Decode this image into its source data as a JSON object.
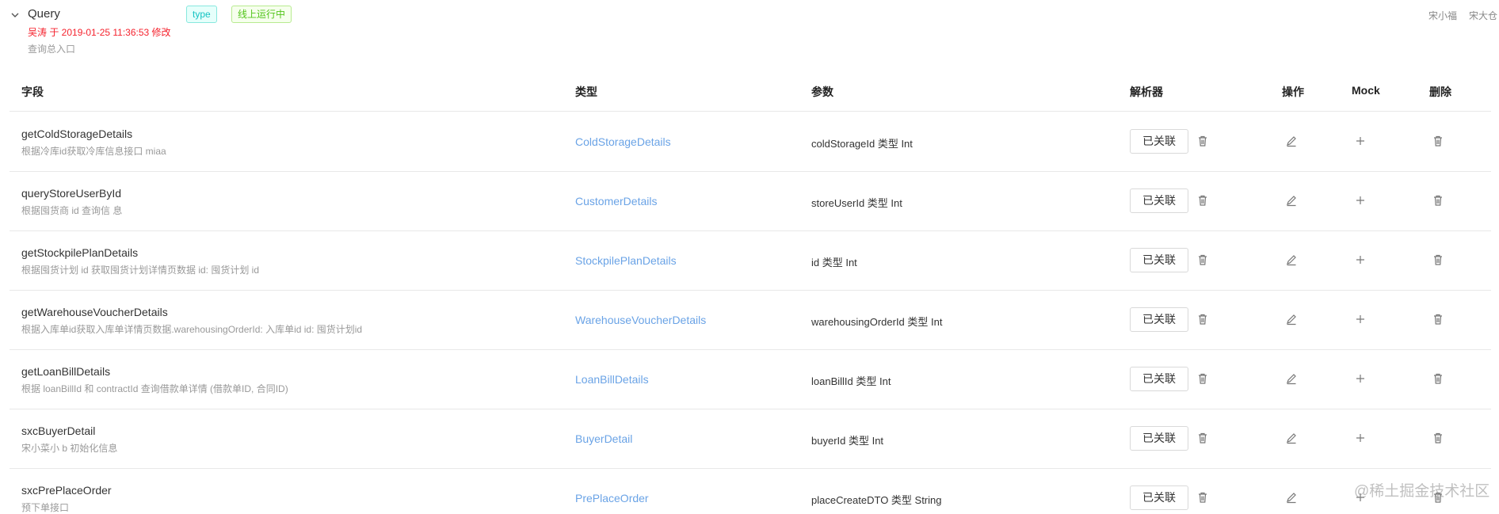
{
  "header": {
    "query_title": "Query",
    "tag_type": "type",
    "tag_status": "线上运行中",
    "modified": "吴涛 于 2019-01-25 11:36:53 修改",
    "description": "查询总入口",
    "users": [
      "宋小福",
      "宋大仓"
    ]
  },
  "table": {
    "columns": [
      "字段",
      "类型",
      "参数",
      "解析器",
      "操作",
      "Mock",
      "删除"
    ],
    "linked_label": "已关联",
    "rows": [
      {
        "field": "getColdStorageDetails",
        "desc": "根据冷库id获取冷库信息接口 miaa",
        "type": "ColdStorageDetails",
        "args": "coldStorageId 类型 Int"
      },
      {
        "field": "queryStoreUserById",
        "desc": "根据囤货商 id 查询信 息",
        "type": "CustomerDetails",
        "args": "storeUserId 类型 Int"
      },
      {
        "field": "getStockpilePlanDetails",
        "desc": "根据囤货计划 id 获取囤货计划详情页数据 id: 囤货计划 id",
        "type": "StockpilePlanDetails",
        "args": "id 类型 Int"
      },
      {
        "field": "getWarehouseVoucherDetails",
        "desc": "根据入库单id获取入库单详情页数据.warehousingOrderId: 入库单id id: 囤货计划id",
        "type": "WarehouseVoucherDetails",
        "args": "warehousingOrderId 类型 Int"
      },
      {
        "field": "getLoanBillDetails",
        "desc": "根据 loanBillId 和 contractId 查询借款单详情 (借款单ID, 合同ID)",
        "type": "LoanBillDetails",
        "args": "loanBillId 类型 Int"
      },
      {
        "field": "sxcBuyerDetail",
        "desc": "宋小菜小 b 初始化信息",
        "type": "BuyerDetail",
        "args": "buyerId 类型 Int"
      },
      {
        "field": "sxcPrePlaceOrder",
        "desc": "预下单接口",
        "type": "PrePlaceOrder",
        "args": "placeCreateDTO 类型 String"
      }
    ]
  },
  "watermark": "@稀土掘金技术社区",
  "colors": {
    "type_link": "#6aa3e6",
    "modified_text": "#f5222d",
    "tag_type": "#13c2c2",
    "tag_status": "#52c41a"
  }
}
